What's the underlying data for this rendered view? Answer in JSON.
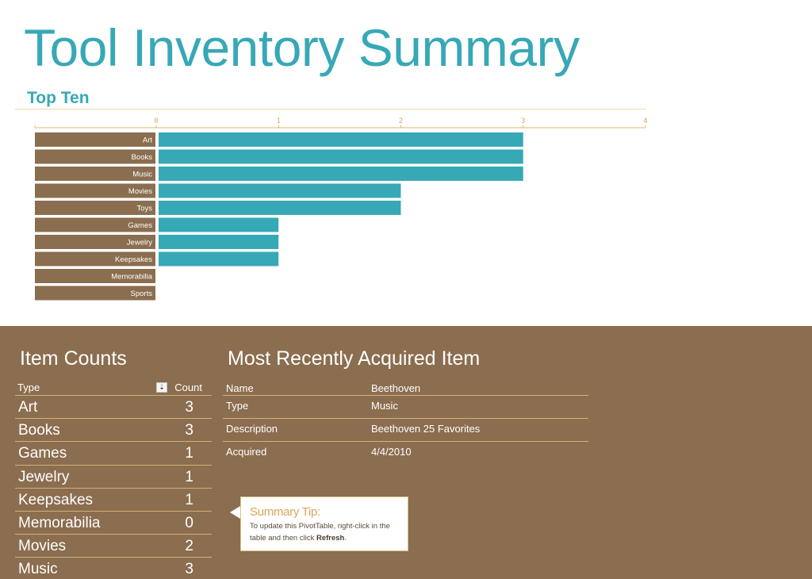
{
  "page": {
    "title": "Tool Inventory Summary",
    "section_title": "Top Ten"
  },
  "colors": {
    "accent_teal": "#37a8b6",
    "brown": "#8b6d4f",
    "axis_gold": "#e0b46a",
    "rule_tan": "#d2b27a",
    "tip_title": "#d9a55a"
  },
  "chart_data": {
    "type": "bar",
    "orientation": "horizontal",
    "title": "Top Ten",
    "categories": [
      "Art",
      "Books",
      "Music",
      "Movies",
      "Toys",
      "Games",
      "Jewelry",
      "Keepsakes",
      "Memorabilia",
      "Sports"
    ],
    "values": [
      3,
      3,
      3,
      2,
      2,
      1,
      1,
      1,
      0,
      0
    ],
    "xlim": [
      0,
      4
    ],
    "xticks": [
      "0",
      "1",
      "2",
      "3",
      "4"
    ],
    "xaxis_position": "top",
    "xlabel": "",
    "ylabel": "",
    "grid": false,
    "legend": "none"
  },
  "item_counts": {
    "title": "Item Counts",
    "header_type": "Type",
    "header_count": "Count",
    "sort_icon": "sort-descending-icon",
    "sort_glyph": "⇣",
    "rows": [
      {
        "type": "Art",
        "count": "3"
      },
      {
        "type": "Books",
        "count": "3"
      },
      {
        "type": "Games",
        "count": "1"
      },
      {
        "type": "Jewelry",
        "count": "1"
      },
      {
        "type": "Keepsakes",
        "count": "1"
      },
      {
        "type": "Memorabilia",
        "count": "0"
      },
      {
        "type": "Movies",
        "count": "2"
      },
      {
        "type": "Music",
        "count": "3"
      }
    ]
  },
  "recent_item": {
    "title": "Most Recently Acquired Item",
    "rows": [
      {
        "key": "Name",
        "value": "Beethoven"
      },
      {
        "key": "Type",
        "value": "Music"
      },
      {
        "key": "Description",
        "value": "Beethoven 25 Favorites"
      },
      {
        "key": "Acquired",
        "value": "4/4/2010"
      }
    ]
  },
  "tip": {
    "title": "Summary Tip:",
    "body_prefix": "To update this PivotTable, right-click in the table and then click ",
    "body_bold": "Refresh",
    "body_suffix": "."
  }
}
